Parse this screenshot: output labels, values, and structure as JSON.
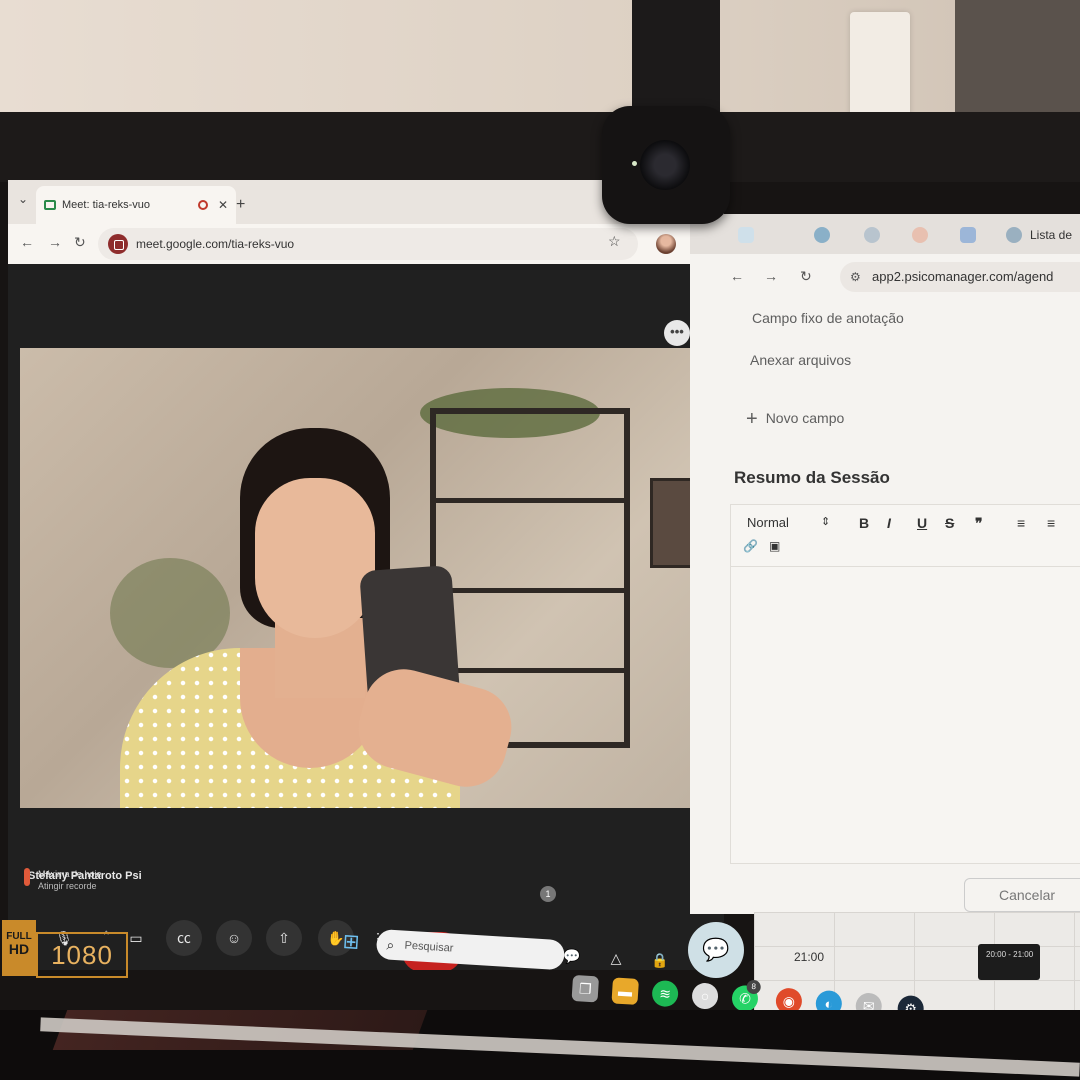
{
  "meet_window": {
    "tab_title": "Meet: tia-reks-vuo",
    "url": "meet.google.com/tia-reks-vuo",
    "participant_name": "Stefany Pantaroto Psi",
    "participants_count": "1",
    "more_options_glyph": "•••",
    "icons": {
      "mic": "microphone-icon",
      "camera": "camera-icon",
      "captions": "captions-icon",
      "emoji": "emoji-icon",
      "present": "present-screen-icon",
      "raise_hand": "raise-hand-icon",
      "more": "more-vert-icon",
      "end_call": "end-call-icon",
      "info": "info-icon",
      "people": "people-icon",
      "chat": "chat-icon",
      "activities": "activities-icon",
      "host_controls": "lock-icon"
    }
  },
  "weather_widget": {
    "title": "Máxima de hoje",
    "subtitle": "Atingir recorde"
  },
  "psico_window": {
    "tab_label": "Lista de",
    "url": "app2.psicomanager.com/agend",
    "menu": {
      "fixed_field": "Campo fixo de anotação",
      "attach_files": "Anexar arquivos",
      "new_field": "Novo campo"
    },
    "section_title": "Resumo da Sessão",
    "editor": {
      "format": "Normal",
      "bold": "B",
      "italic": "I",
      "underline": "U",
      "strike": "S",
      "quote": "❞"
    },
    "cancel_label": "Cancelar"
  },
  "calendar": {
    "time_label": "21:00",
    "event_label": "20:00 - 21:00"
  },
  "taskbar": {
    "search_placeholder": "Pesquisar",
    "whatsapp_badge": "8"
  },
  "overlay": {
    "fhd_top": "FULL",
    "fhd_bottom": "HD",
    "resolution": "1080"
  },
  "colors": {
    "end_call": "#c5221f",
    "overlay_gold": "#c98a2a"
  }
}
